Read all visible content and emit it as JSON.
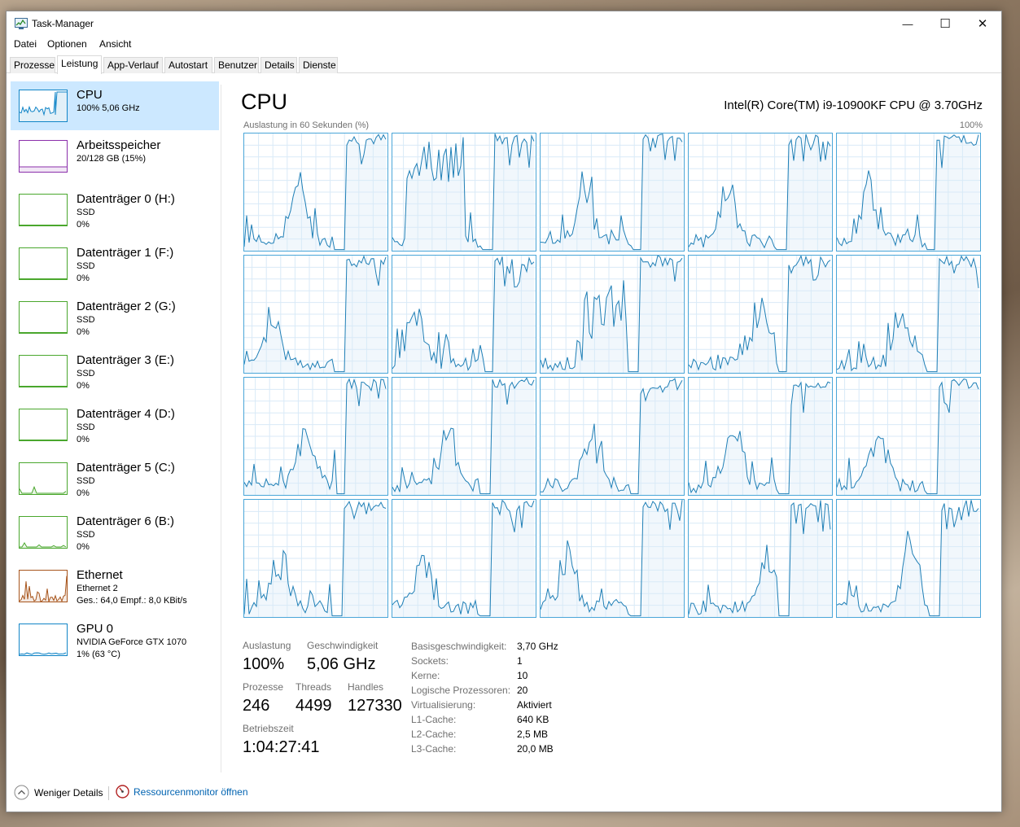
{
  "window": {
    "title": "Task-Manager",
    "controls": {
      "minimize": "—",
      "maximize": "☐",
      "close": "✕"
    }
  },
  "menu": [
    "Datei",
    "Optionen",
    "Ansicht"
  ],
  "tabs": [
    "Prozesse",
    "Leistung",
    "App-Verlauf",
    "Autostart",
    "Benutzer",
    "Details",
    "Dienste"
  ],
  "active_tab": "Leistung",
  "sidebar": {
    "items": [
      {
        "title": "CPU",
        "line1": "100%  5,06 GHz",
        "line2": "",
        "color": "#1185c7",
        "active": true,
        "level": 1.0
      },
      {
        "title": "Arbeitsspeicher",
        "line1": "20/128 GB (15%)",
        "line2": "",
        "color": "#8b2fab",
        "level": 0.15
      },
      {
        "title": "Datenträger 0 (H:)",
        "line1": "SSD",
        "line2": "0%",
        "color": "#4aa72d",
        "level": 0
      },
      {
        "title": "Datenträger 1 (F:)",
        "line1": "SSD",
        "line2": "0%",
        "color": "#4aa72d",
        "level": 0
      },
      {
        "title": "Datenträger 2 (G:)",
        "line1": "SSD",
        "line2": "0%",
        "color": "#4aa72d",
        "level": 0
      },
      {
        "title": "Datenträger 3 (E:)",
        "line1": "SSD",
        "line2": "0%",
        "color": "#4aa72d",
        "level": 0
      },
      {
        "title": "Datenträger 4 (D:)",
        "line1": "SSD",
        "line2": "0%",
        "color": "#4aa72d",
        "level": 0
      },
      {
        "title": "Datenträger 5 (C:)",
        "line1": "SSD",
        "line2": "0%",
        "color": "#4aa72d",
        "level": 0
      },
      {
        "title": "Datenträger 6 (B:)",
        "line1": "SSD",
        "line2": "0%",
        "color": "#4aa72d",
        "level": 0
      },
      {
        "title": "Ethernet",
        "line1": "Ethernet 2",
        "line2": "Ges.: 64,0  Empf.: 8,0 KBit/s",
        "color": "#a7541b",
        "level": 0.5
      },
      {
        "title": "GPU 0",
        "line1": "NVIDIA GeForce GTX 1070",
        "line2": "1% (63 °C)",
        "color": "#1185c7",
        "level": 0.01
      }
    ]
  },
  "main": {
    "title": "CPU",
    "cpu_model": "Intel(R) Core(TM) i9-10900KF CPU @ 3.70GHz",
    "graph_label": "Auslastung in 60 Sekunden (%)",
    "graph_max": "100%",
    "core_count": 20,
    "accent_color": "#1f7fb6",
    "fill_color": "#f1f7fc"
  },
  "stats": {
    "auslastung_label": "Auslastung",
    "auslastung_value": "100%",
    "geschwindigkeit_label": "Geschwindigkeit",
    "geschwindigkeit_value": "5,06 GHz",
    "prozesse_label": "Prozesse",
    "prozesse_value": "246",
    "threads_label": "Threads",
    "threads_value": "4499",
    "handles_label": "Handles",
    "handles_value": "127330",
    "betriebszeit_label": "Betriebszeit",
    "betriebszeit_value": "1:04:27:41"
  },
  "specs": [
    {
      "label": "Basisgeschwindigkeit:",
      "value": "3,70 GHz"
    },
    {
      "label": "Sockets:",
      "value": "1"
    },
    {
      "label": "Kerne:",
      "value": "10"
    },
    {
      "label": "Logische Prozessoren:",
      "value": "20"
    },
    {
      "label": "Virtualisierung:",
      "value": "Aktiviert"
    },
    {
      "label": "L1-Cache:",
      "value": "640 KB"
    },
    {
      "label": "L2-Cache:",
      "value": "2,5 MB"
    },
    {
      "label": "L3-Cache:",
      "value": "20,0 MB"
    }
  ],
  "footer": {
    "fewer_details": "Weniger Details",
    "resource_monitor": "Ressourcenmonitor öffnen",
    "link_color": "#0063b1"
  }
}
